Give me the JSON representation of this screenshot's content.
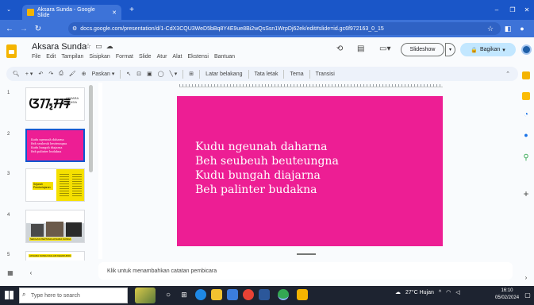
{
  "browser": {
    "tab_title": "Aksara Sunda - Google Slide",
    "url": "docs.google.com/presentation/d/1-CdX3CQU3WeD5bBq8Y4E9ue8Bi2wQsSsn1WrpDj62ek/edit#slide=id.gc6f972163_0_15"
  },
  "app": {
    "doc_title": "Aksara Sunda",
    "menu": [
      "File",
      "Edit",
      "Tampilan",
      "Sisipkan",
      "Format",
      "Slide",
      "Atur",
      "Alat",
      "Ekstensi",
      "Bantuan"
    ],
    "slideshow_label": "Slideshow",
    "share_label": "Bagikan"
  },
  "toolbar": {
    "paskan_label": "Paskan",
    "background_label": "Latar belakang",
    "layout_label": "Tata letak",
    "theme_label": "Tema",
    "transition_label": "Transisi"
  },
  "filmstrip": {
    "slides": [
      {
        "number": "1",
        "sunda_text": "ᮃᮊ᮪ᮞᮛ",
        "caption": "AKSARA SUNDA"
      },
      {
        "number": "2",
        "lines": [
          "Kudu ngeunah daharna",
          "Beh seubeuh beuteungna",
          "Kudu bungah diajarna",
          "Beh palinter budakna"
        ]
      },
      {
        "number": "3",
        "label": "Sejarah Pembelajaran"
      },
      {
        "number": "4",
        "caption": "SEKILAS PERTAMA AKSARA SUNDA"
      },
      {
        "number": "5",
        "caption": "AKSARA SUNDA DALAM KEHIDUPAN"
      }
    ]
  },
  "slide": {
    "color": "#ed1e94",
    "lines": "Kudu ngeunah daharna\nBeh seubeuh beuteungna\nKudu bungah diajarna\nBeh palinter budakna"
  },
  "notes": {
    "placeholder": "Klik untuk menambahkan catatan pembicara"
  },
  "taskbar": {
    "search_placeholder": "Type here to search",
    "weather": "27°C Hujan",
    "time": "16:10",
    "date": "05/02/2024"
  }
}
